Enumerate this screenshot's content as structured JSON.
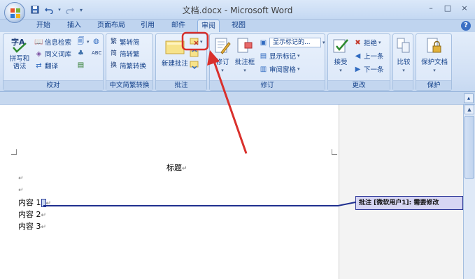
{
  "window": {
    "title": "文档.docx - Microsoft Word",
    "controls": [
      "–",
      "□",
      "×"
    ]
  },
  "qat": {
    "icons": [
      "save-icon",
      "undo-icon",
      "redo-icon",
      "customize-icon"
    ],
    "glyphs": [
      "💾",
      "↶",
      "↷",
      "▾"
    ]
  },
  "tabs": [
    {
      "label": "开始",
      "active": false
    },
    {
      "label": "插入",
      "active": false
    },
    {
      "label": "页面布局",
      "active": false
    },
    {
      "label": "引用",
      "active": false
    },
    {
      "label": "邮件",
      "active": false
    },
    {
      "label": "审阅",
      "active": true
    },
    {
      "label": "视图",
      "active": false
    }
  ],
  "help": "?",
  "ribbon": {
    "proofing": {
      "label": "校对",
      "spelling": "拼写和\n语法",
      "research": "信息检索",
      "thesaurus": "同义词库",
      "translate": "翻译"
    },
    "chinese": {
      "label": "中文简繁转换",
      "to_simplified": "繁转简",
      "to_traditional": "简转繁",
      "convert": "简繁转换"
    },
    "comments": {
      "label": "批注",
      "new_comment": "新建批注"
    },
    "tracking": {
      "label": "修订",
      "track_changes": "修订",
      "balloons": "批注框",
      "display_for_review": "显示标记的...",
      "show_markup": "显示标记",
      "reviewing_pane": "审阅窗格"
    },
    "changes": {
      "label": "更改",
      "accept": "接受",
      "reject": "拒绝",
      "previous": "上一条",
      "next": "下一条"
    },
    "compare": {
      "compare": "比较"
    },
    "protect": {
      "label": "保护",
      "protect_document": "保护文档"
    }
  },
  "document": {
    "title_line": "标题",
    "lines": [
      "内容 1",
      "内容 2",
      "内容 3"
    ],
    "comment": "批注 [微软用户1]: 需要修改"
  },
  "colors": {
    "ribbon_text": "#15428b",
    "annotation_red": "#d9302c",
    "comment_border": "#2b3596",
    "comment_fill": "#d7d6f3"
  }
}
